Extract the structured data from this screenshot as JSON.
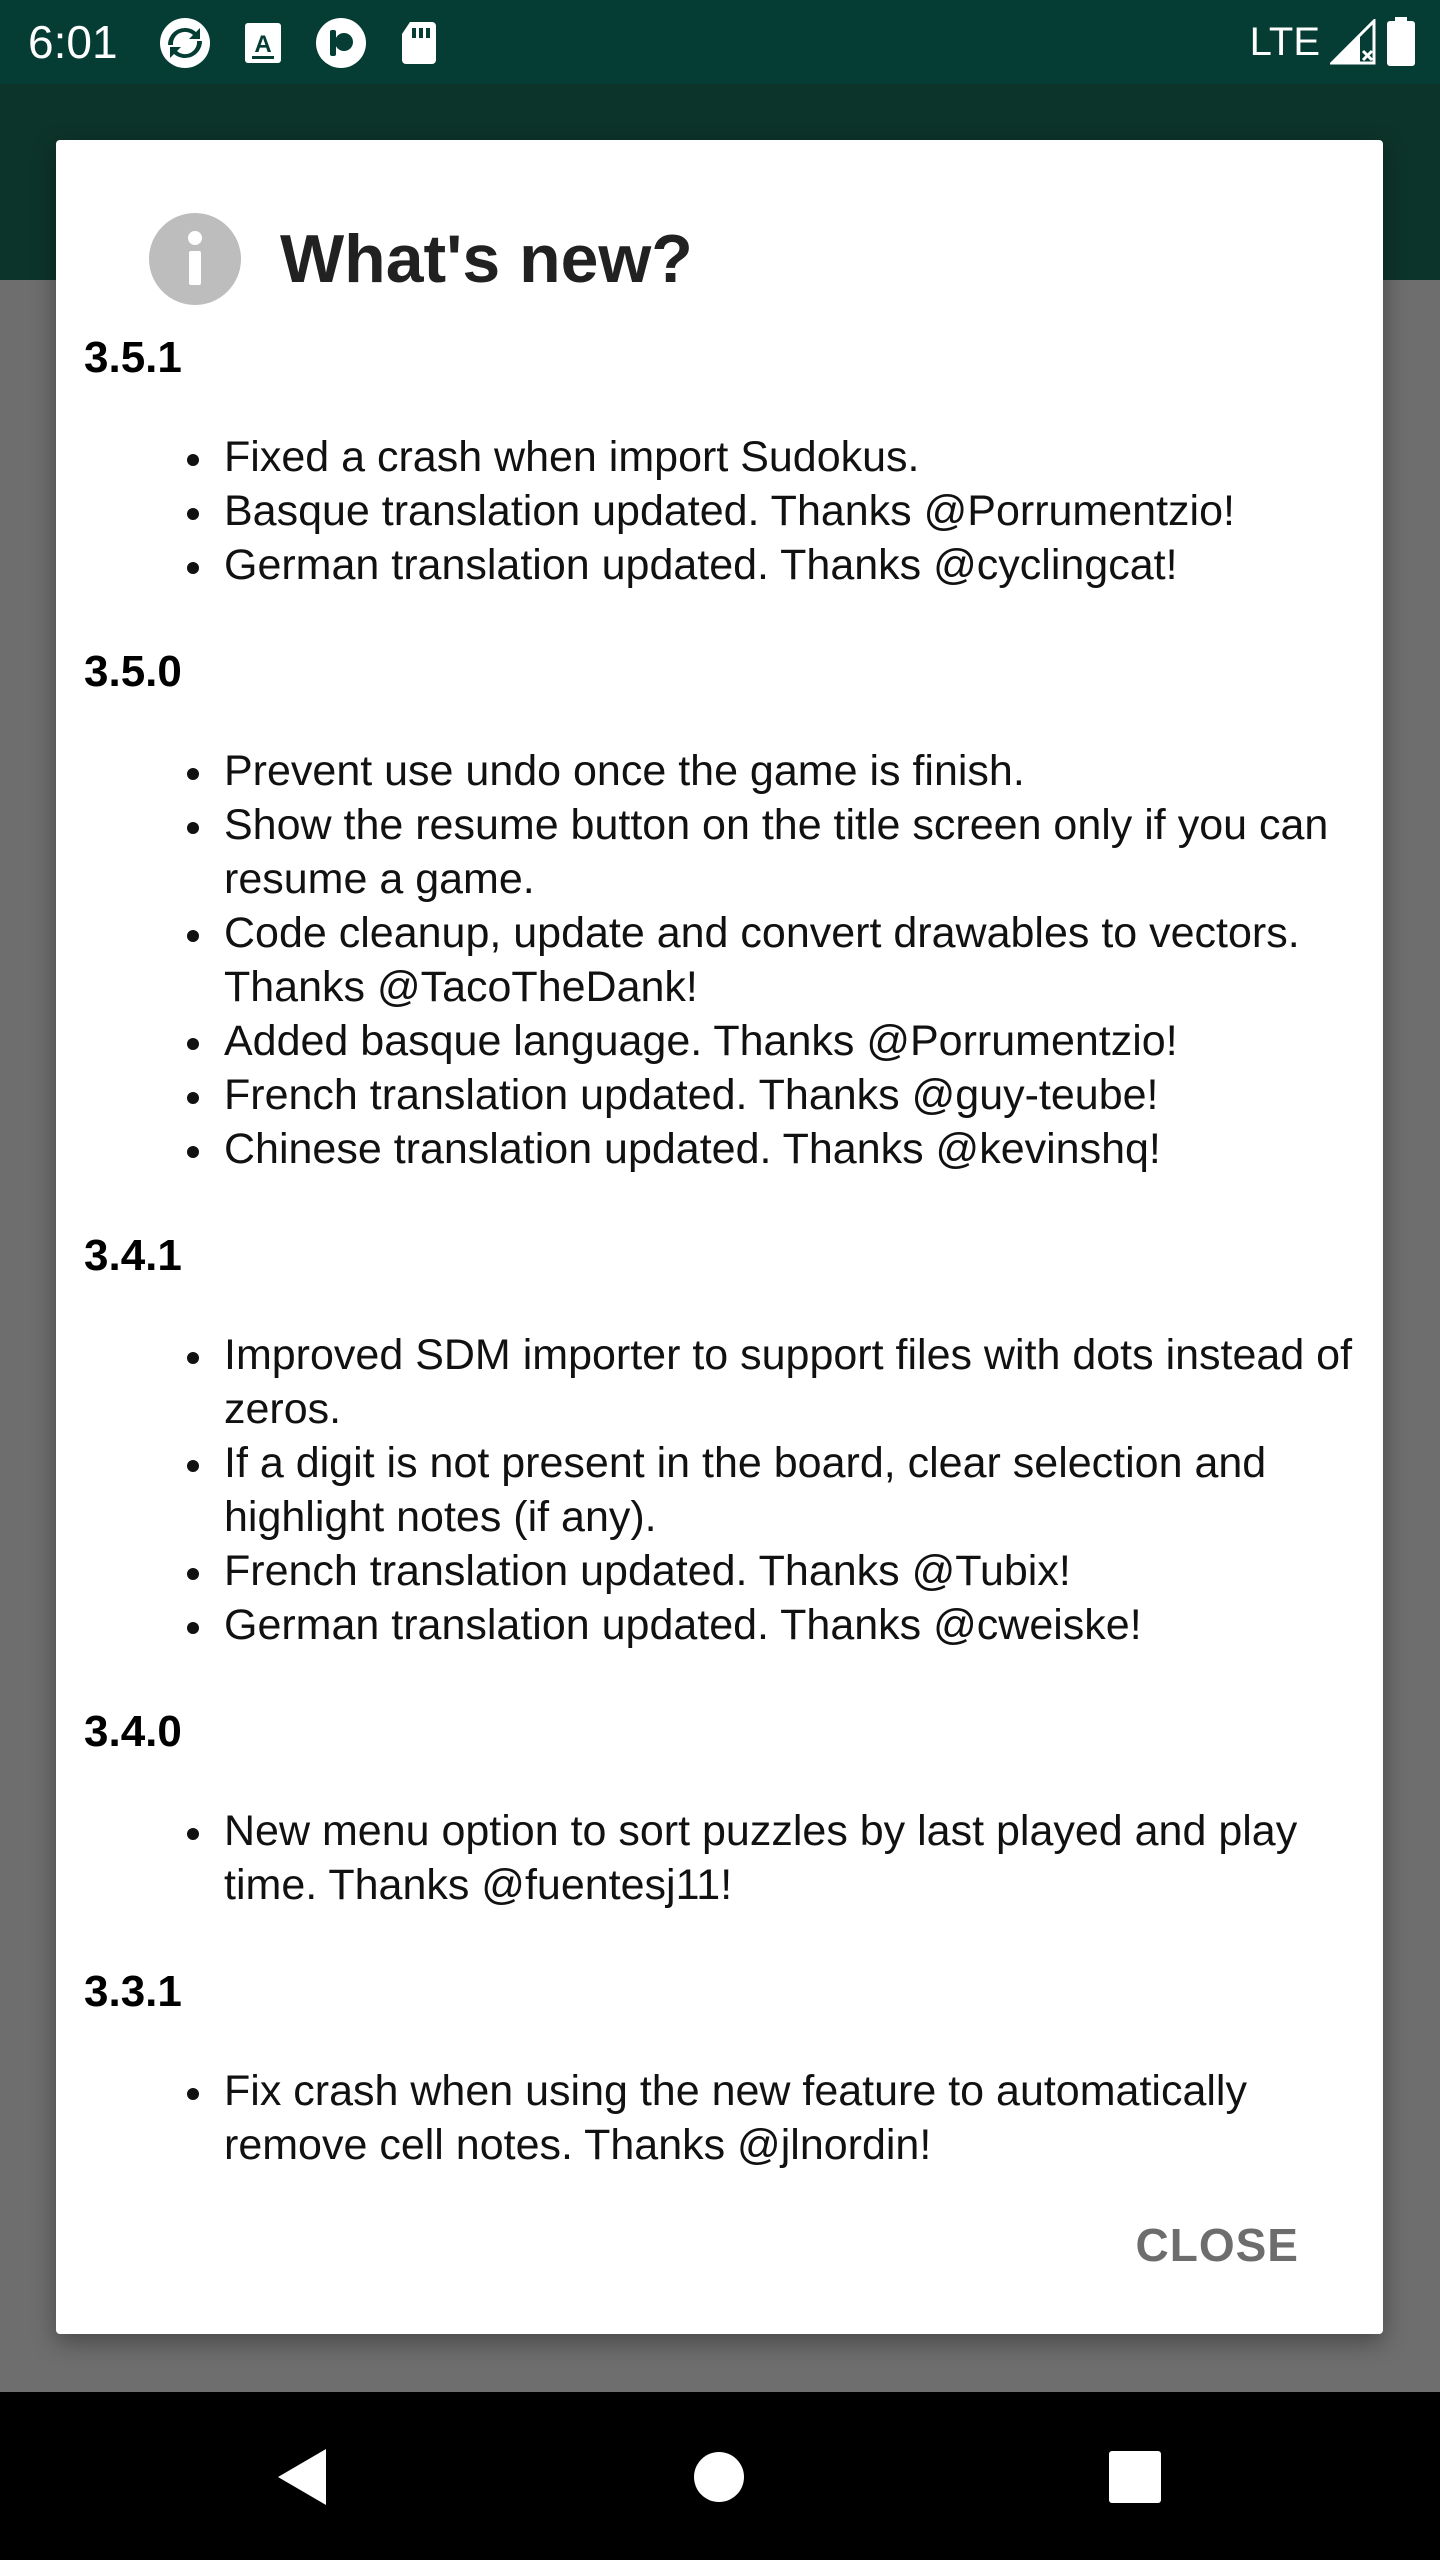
{
  "status_bar": {
    "time": "6:01",
    "network": "LTE",
    "icons": [
      "sync-icon",
      "font-icon",
      "app-circle-icon",
      "sd-card-icon",
      "signal-icon",
      "battery-icon"
    ]
  },
  "dialog": {
    "icon": "info-icon",
    "title": "What's new?",
    "close_label": "CLOSE",
    "releases": [
      {
        "version": "3.5.1",
        "changes": [
          "Fixed a crash when import Sudokus.",
          "Basque translation updated. Thanks @Porrumentzio!",
          "German translation updated. Thanks @cyclingcat!"
        ]
      },
      {
        "version": "3.5.0",
        "changes": [
          "Prevent use undo once the game is finish.",
          "Show the resume button on the title screen only if you can resume a game.",
          "Code cleanup, update and convert drawables to vectors. Thanks @TacoTheDank!",
          "Added basque language. Thanks @Porrumentzio!",
          "French translation updated. Thanks @guy-teube!",
          "Chinese translation updated. Thanks @kevinshq!"
        ]
      },
      {
        "version": "3.4.1",
        "changes": [
          "Improved SDM importer to support files with dots instead of zeros.",
          "If a digit is not present in the board, clear selection and highlight notes (if any).",
          "French translation updated. Thanks @Tubix!",
          "German translation updated. Thanks @cweiske!"
        ]
      },
      {
        "version": "3.4.0",
        "changes": [
          "New menu option to sort puzzles by last played and play time. Thanks @fuentesj11!"
        ]
      },
      {
        "version": "3.3.1",
        "changes": [
          "Fix crash when using the new feature to automatically remove cell notes. Thanks @jlnordin!"
        ]
      }
    ]
  },
  "nav_bar": {
    "buttons": [
      "back-icon",
      "home-icon",
      "recents-icon"
    ]
  },
  "colors": {
    "status_bar": "#053d34",
    "app_bar": "#1f7a63",
    "close_text": "#6d6d6d",
    "info_icon": "#bdbdbd"
  }
}
